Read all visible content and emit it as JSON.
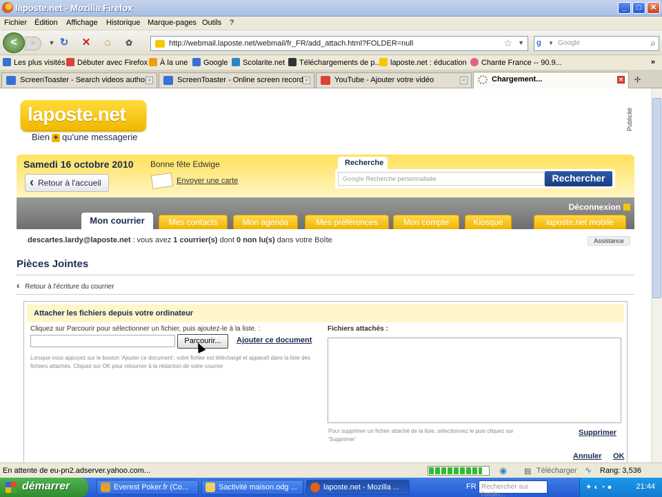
{
  "window": {
    "title": "laposte.net - Mozilla Firefox",
    "minimize": "_",
    "maximize": "□",
    "close": "✕"
  },
  "menu": [
    "Fichier",
    "Édition",
    "Affichage",
    "Historique",
    "Marque-pages",
    "Outils",
    "?"
  ],
  "navbar": {
    "url": "http://webmail.laposte.net/webmail/fr_FR/add_attach.html?FOLDER=null",
    "search_placeholder": "Google",
    "back": "<",
    "forward": ">"
  },
  "bookmarks": [
    {
      "label": "Les plus visités",
      "color": "#3a6fd8"
    },
    {
      "label": "Débuter avec Firefox",
      "color": "#d9433a"
    },
    {
      "label": "À la une",
      "color": "#f39c12"
    },
    {
      "label": "Google",
      "color": "#3a6fd8"
    },
    {
      "label": "Scolarite.net",
      "color": "#2e86c1"
    },
    {
      "label": "Téléchargements de p...",
      "color": "#333333"
    },
    {
      "label": "laposte.net : éducation",
      "color": "#f3c800"
    },
    {
      "label": "Chante France -- 90.9...",
      "color": "#e0608a"
    }
  ],
  "tabs": [
    {
      "label": "ScreenToaster - Search videos author...",
      "active": false,
      "color": "#3a6fd8"
    },
    {
      "label": "ScreenToaster - Online screen record...",
      "active": false,
      "color": "#3a6fd8"
    },
    {
      "label": "YouTube - Ajouter votre vidéo",
      "active": false,
      "color": "#d9433a"
    },
    {
      "label": "Chargement...",
      "active": true,
      "color": "#888888"
    }
  ],
  "site": {
    "logo": "laposte.net",
    "tagline_left": "Bien",
    "tagline_plus": "+",
    "tagline_right": "qu'une messagerie",
    "pub": "Publicité",
    "date": "Samedi 16 octobre 2010",
    "fete": "Bonne fête Edwige",
    "back_home": "Retour à l'accueil",
    "send_card": "Envoyer une carte",
    "search_tab": "Recherche",
    "search_placeholder": "Recherche personnalisée",
    "search_brand": "Google",
    "search_button": "Rechercher",
    "logout": "Déconnexion",
    "nav_tabs": [
      "Mon courrier",
      "Mes contacts",
      "Mon agenda",
      "Mes préférences",
      "Mon compte",
      "Kiosque",
      "laposte.net mobile"
    ],
    "info": {
      "email": "descartes.lardy@laposte.net",
      "text1": " : vous avez ",
      "count": "1 courrier(s)",
      "text2": " dont ",
      "unread": "0 non lu(s)",
      "text3": " dans votre Boîte"
    },
    "assistance": "Assistance"
  },
  "attach": {
    "title": "Pièces Jointes",
    "back_link": "Retour à l'écriture du courrier",
    "panel_title": "Attacher les fichiers depuis votre ordinateur",
    "instruction": "Cliquez sur Parcourir pour sélectionner un fichier, puis ajoutez-le à la liste. :",
    "browse": "Parcourir...",
    "add_doc": "Ajouter ce document",
    "help_text": "Lorsque vous appuyez sur le bouton 'Ajouter ce document', votre fichier est téléchargé et apparaît dans la liste des fichiers attachés. Cliquez sur OK pour retourner à la rédaction de votre courrier",
    "attached_label": "Fichiers attachés :",
    "remove_help": "Pour supprimer un fichier attaché de la liste, sélectionnez le puis cliquez sur 'Supprimer'",
    "remove": "Supprimer",
    "cancel": "Annuler",
    "ok": "OK"
  },
  "statusbar": {
    "status": "En attente de eu-pn2.adserver.yahoo.com...",
    "progress": 0.9,
    "telecharger": "Télécharger",
    "rang": "Rang: 3,536"
  },
  "taskbar": {
    "start": "démarrer",
    "tasks": [
      {
        "label": "Everest Poker.fr (Co...",
        "color": "#e0a030"
      },
      {
        "label": "Sactivité maison.odg ...",
        "color": "#f0d060"
      },
      {
        "label": "laposte.net - Mozilla ...",
        "color": "#e0621a"
      }
    ],
    "lang": "FR",
    "search_placeholder": "Rechercher sur l'ordin...",
    "clock": "21:44"
  }
}
